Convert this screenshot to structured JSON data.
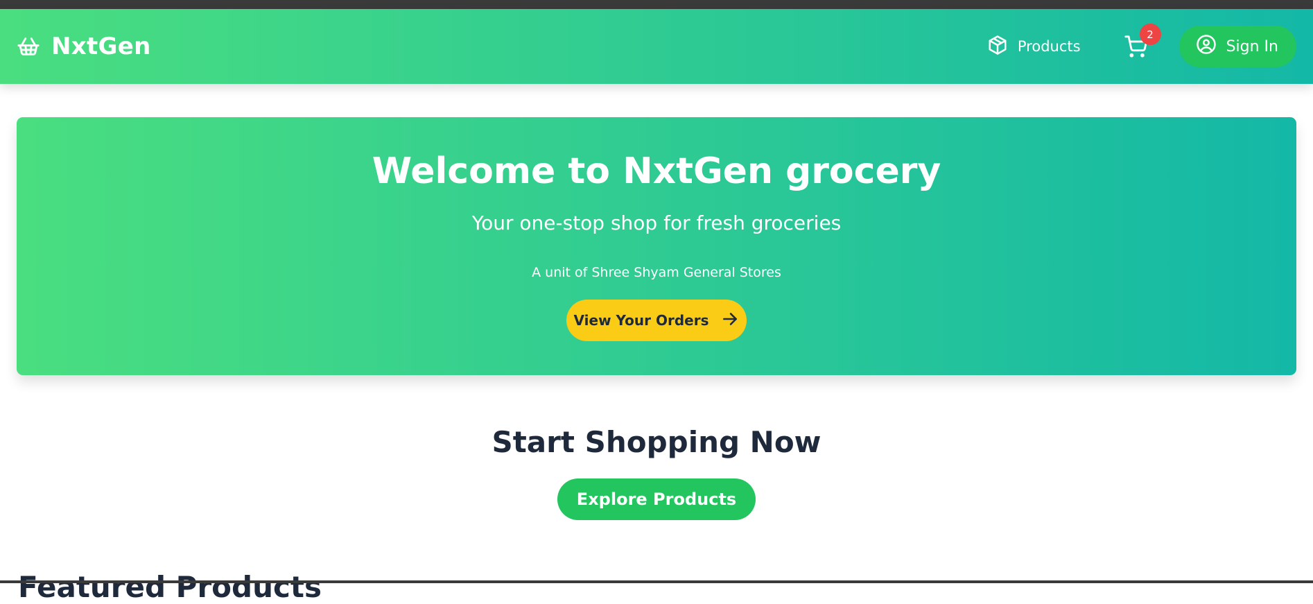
{
  "brand": {
    "name": "NxtGen",
    "icon": "basket-icon"
  },
  "nav": {
    "products_label": "Products",
    "products_icon": "package-icon",
    "cart_icon": "cart-icon",
    "cart_count": "2",
    "signin_label": "Sign In",
    "signin_icon": "user-circle-icon"
  },
  "hero": {
    "title": "Welcome to NxtGen grocery",
    "subtitle": "Your one-stop shop for fresh groceries",
    "unit": "A unit of Shree Shyam General Stores",
    "orders_button": "View Your Orders",
    "orders_icon": "arrow-right-icon"
  },
  "shop": {
    "title": "Start Shopping Now",
    "explore_button": "Explore Products"
  },
  "featured": {
    "title": "Featured Products"
  },
  "colors": {
    "gradient_start": "#4ade80",
    "gradient_end": "#14b8a6",
    "green_button": "#22c55e",
    "yellow_button": "#facc15",
    "badge": "#ef4444",
    "heading": "#1e293b"
  }
}
